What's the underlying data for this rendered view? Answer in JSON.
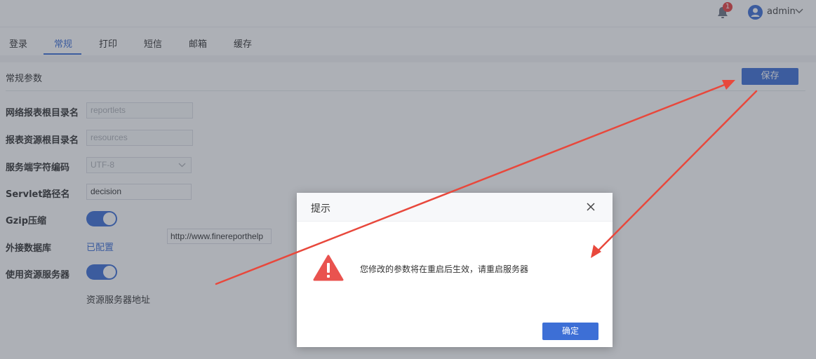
{
  "header": {
    "notification_count": "1",
    "user_name": "admin"
  },
  "tabs": [
    {
      "label": "登录"
    },
    {
      "label": "常规"
    },
    {
      "label": "打印"
    },
    {
      "label": "短信"
    },
    {
      "label": "邮箱"
    },
    {
      "label": "缓存"
    }
  ],
  "section": {
    "title": "常规参数",
    "save_label": "保存"
  },
  "form": {
    "web_report_root_label": "网络报表根目录名",
    "web_report_root_placeholder": "reportlets",
    "resource_root_label": "报表资源根目录名",
    "resource_root_placeholder": "resources",
    "charset_label": "服务端字符编码",
    "charset_value": "UTF-8",
    "servlet_label": "Servlet路径名",
    "servlet_value": "decision",
    "gzip_label": "Gzip压缩",
    "gzip_on": true,
    "external_db_label": "外接数据库",
    "external_db_link": "已配置",
    "resource_server_label": "使用资源服务器",
    "resource_server_on": true,
    "resource_server_addr_label": "资源服务器地址",
    "resource_server_addr_value": "http://www.finereporthelp"
  },
  "dialog": {
    "title": "提示",
    "message": "您修改的参数将在重启后生效，请重启服务器",
    "ok_label": "确定"
  },
  "colors": {
    "accent": "#3d6fd6",
    "warning": "#e9534f",
    "annotation_arrow": "#e8483c"
  }
}
